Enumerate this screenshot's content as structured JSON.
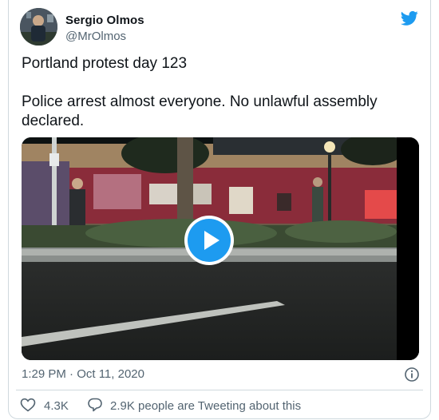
{
  "author": {
    "name": "Sergio Olmos",
    "handle": "@MrOlmos"
  },
  "tweet": {
    "line1": "Portland protest day 123",
    "line2": "Police arrest almost everyone.  No unlawful assembly",
    "line3": "declared."
  },
  "meta": {
    "timestamp": "1:29 PM · Oct 11, 2020"
  },
  "actions": {
    "likes": "4.3K",
    "talking": "2.9K people are Tweeting about this"
  },
  "icons": {
    "bird": "twitter-bird-icon",
    "play": "play-icon",
    "info": "info-icon",
    "heart": "heart-icon",
    "bubble": "speech-bubble-icon"
  },
  "colors": {
    "accent": "#1d9bf0",
    "secondary_text": "#536471"
  }
}
